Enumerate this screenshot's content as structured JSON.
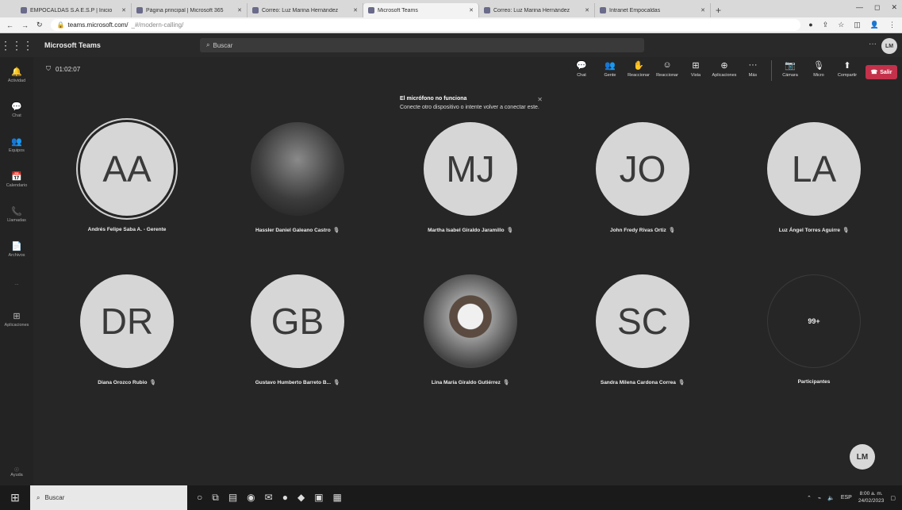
{
  "browser": {
    "tabs": [
      {
        "title": "EMPOCALDAS S.A E.S.P | Inicio",
        "active": false
      },
      {
        "title": "Página principal | Microsoft 365",
        "active": false
      },
      {
        "title": "Correo: Luz Marina Hernández",
        "active": false
      },
      {
        "title": "Microsoft Teams",
        "active": true
      },
      {
        "title": "Correo: Luz Marina Hernández",
        "active": false
      },
      {
        "title": "Intranet Empocaldas",
        "active": false
      }
    ],
    "new_tab": "+",
    "url_host": "teams.microsoft.com/",
    "url_path": "_#/modern-calling/"
  },
  "teams": {
    "app_name": "Microsoft Teams",
    "search_placeholder": "Buscar",
    "more": "···",
    "user_initials": "LM"
  },
  "rail": [
    {
      "label": "Actividad",
      "icon": "bell-icon",
      "glyph": "🔔"
    },
    {
      "label": "Chat",
      "icon": "chat-icon",
      "glyph": "💬"
    },
    {
      "label": "Equipos",
      "icon": "teams-icon",
      "glyph": "👥"
    },
    {
      "label": "Calendario",
      "icon": "calendar-icon",
      "glyph": "📅"
    },
    {
      "label": "Llamadas",
      "icon": "phone-icon",
      "glyph": "📞"
    },
    {
      "label": "Archivos",
      "icon": "file-icon",
      "glyph": "📄"
    },
    {
      "label": "···",
      "icon": "more-icon",
      "glyph": ""
    },
    {
      "label": "Aplicaciones",
      "icon": "apps-icon",
      "glyph": "⊞"
    }
  ],
  "rail_help": "Ayuda",
  "call": {
    "timer": "01:02:07",
    "toolbar": [
      {
        "label": "Chat",
        "icon": "chat-icon",
        "glyph": "💬"
      },
      {
        "label": "Gente",
        "icon": "people-icon",
        "glyph": "👥"
      },
      {
        "label": "Reaccionar",
        "icon": "hand-icon",
        "glyph": "✋"
      },
      {
        "label": "Reaccionar",
        "icon": "smile-icon",
        "glyph": "☺"
      },
      {
        "label": "Vista",
        "icon": "view-icon",
        "glyph": "⊞"
      },
      {
        "label": "Aplicaciones",
        "icon": "apps-icon",
        "glyph": "⊕"
      },
      {
        "label": "Más",
        "icon": "more-icon",
        "glyph": "···"
      }
    ],
    "devices": [
      {
        "label": "Cámara",
        "icon": "camera-icon",
        "glyph": "📷"
      },
      {
        "label": "Micro",
        "icon": "mic-icon",
        "glyph": "🎙"
      },
      {
        "label": "Compartir",
        "icon": "share-icon",
        "glyph": "⬆"
      }
    ],
    "leave_label": "Salir",
    "toast": {
      "title": "El micrófono no funciona",
      "body": "Conecte otro dispositivo o intente volver a conectar este."
    }
  },
  "participants": [
    {
      "initials": "AA",
      "name": "Andrés Felipe Saba A. - Gerente",
      "photo": false
    },
    {
      "initials": "",
      "name": "Hassler Daniel Galeano Castro",
      "photo": true
    },
    {
      "initials": "MJ",
      "name": "Martha Isabel Giraldo Jaramillo",
      "photo": false
    },
    {
      "initials": "JO",
      "name": "John Fredy Rivas Ortiz",
      "photo": false
    },
    {
      "initials": "LA",
      "name": "Luz Ángel Torres Aguirre",
      "photo": false
    },
    {
      "initials": "DR",
      "name": "Diana Orozco Rubio",
      "photo": false
    },
    {
      "initials": "GB",
      "name": "Gustavo Humberto Barreto B...",
      "photo": false
    },
    {
      "initials": "",
      "name": "Lina María Giraldo Gutiérrez",
      "photo": true
    },
    {
      "initials": "SC",
      "name": "Sandra Milena Cardona Correa",
      "photo": false
    }
  ],
  "overflow": {
    "count": "99+",
    "label": "Participantes"
  },
  "self_initials": "LM",
  "taskbar": {
    "search": "Buscar",
    "tray_lang": "ESP",
    "time": "8:00 a. m.",
    "date": "24/02/2023"
  }
}
